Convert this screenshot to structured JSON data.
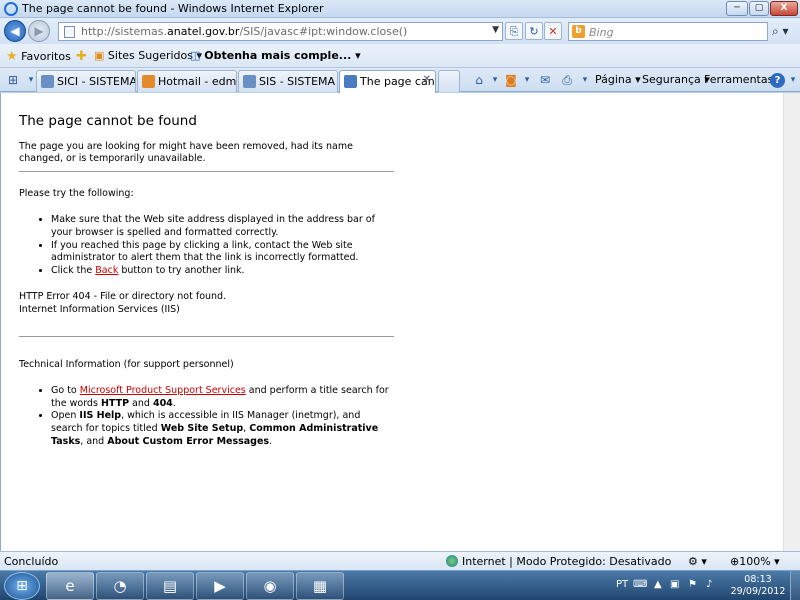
{
  "window": {
    "title": "The page cannot be found - Windows Internet Explorer",
    "min_label": "─",
    "max_label": "▢",
    "close_label": "X"
  },
  "address": {
    "url_prefix": "http://sistemas.",
    "url_domain": "anatel.gov.br",
    "url_suffix": "/SIS/javasc#ipt:window.close()"
  },
  "search": {
    "placeholder": "Bing"
  },
  "favorites": {
    "favorites_label": "Favoritos",
    "suggested_label": "Sites Sugeridos ▾",
    "more_label": "Obtenha mais comple... ▾"
  },
  "tabs": [
    {
      "label": "SICI - SISTEMA D..."
    },
    {
      "label": "Hotmail - edmar..."
    },
    {
      "label": "SIS - SISTEMA DE..."
    },
    {
      "label": "The page can..."
    }
  ],
  "commands": {
    "page": "Página ▾",
    "security": "Segurança ▾",
    "tools": "Ferramentas ▾"
  },
  "page": {
    "heading": "The page cannot be found",
    "intro": "The page you are looking for might have been removed, had its name changed, or is temporarily unavailable.",
    "try_heading": "Please try the following:",
    "try_items": [
      "Make sure that the Web site address displayed in the address bar of your browser is spelled and formatted correctly.",
      "If you reached this page by clicking a link, contact the Web site administrator to alert them that the link is incorrectly formatted."
    ],
    "click_pre": "Click the ",
    "back_link": "Back",
    "click_post": " button to try another link.",
    "error_line1": "HTTP Error 404 - File or directory not found.",
    "error_line2": "Internet Information Services (IIS)",
    "tech_heading": "Technical Information (for support personnel)",
    "goto_pre": "Go to ",
    "support_link": "Microsoft Product Support Services",
    "goto_mid": " and perform a title search for the words ",
    "http_word": "HTTP",
    "and_word": " and ",
    "code_word": "404",
    "period": ".",
    "open_pre": "Open ",
    "iis_help": "IIS Help",
    "open_mid": ", which is accessible in IIS Manager (inetmgr), and search for topics titled ",
    "topic1": "Web Site Setup",
    "comma1": ", ",
    "topic2": "Common Administrative Tasks",
    "and2": ", and ",
    "topic3": "About Custom Error Messages",
    "period2": "."
  },
  "status": {
    "left": "Concluído",
    "zone": "Internet | Modo Protegido: Desativado",
    "zoom": "100%"
  },
  "taskbar": {
    "lang": "PT",
    "time": "08:13",
    "date": "29/09/2012"
  }
}
